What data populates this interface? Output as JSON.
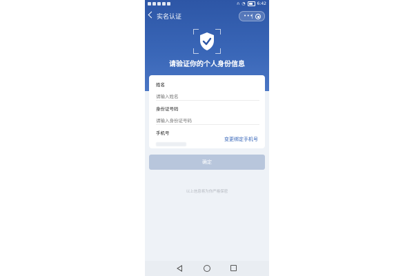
{
  "status_bar": {
    "time": "6:42"
  },
  "nav": {
    "title": "实名认证",
    "capsule_dots": "•••"
  },
  "hero": {
    "title": "请验证你的个人身份信息"
  },
  "form": {
    "name": {
      "label": "姓名",
      "placeholder": "请输入姓名"
    },
    "id_number": {
      "label": "身份证号码",
      "placeholder": "请输入身份证号码"
    },
    "phone": {
      "label": "手机号",
      "change_link": "变更绑定手机号"
    }
  },
  "confirm_label": "确定",
  "notice": "以上信息将为你严格保密",
  "colors": {
    "primary": "#2d56a6",
    "link": "#3665b8",
    "button_disabled": "#b8c6dc"
  },
  "icons": [
    "back-arrow-icon",
    "more-dots-icon",
    "close-target-icon",
    "shield-check-icon",
    "nav-back-icon",
    "nav-home-icon",
    "nav-recent-icon"
  ]
}
